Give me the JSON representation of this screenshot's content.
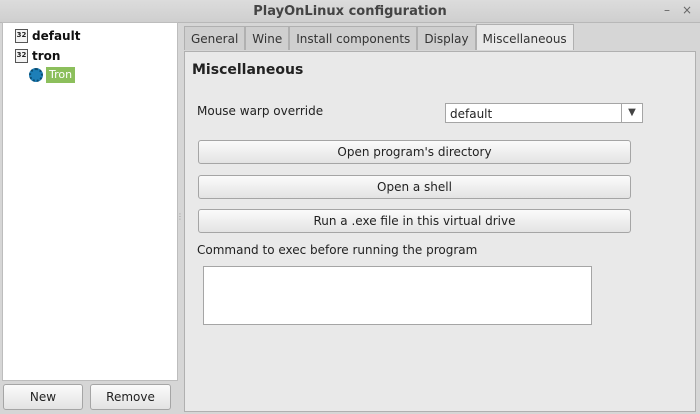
{
  "window": {
    "title": "PlayOnLinux configuration",
    "minimize_glyph": "–",
    "close_glyph": "×"
  },
  "tree": {
    "items": [
      {
        "label": "default",
        "icon": "chip-32-icon",
        "chip_text": "32"
      },
      {
        "label": "tron",
        "icon": "chip-32-icon",
        "chip_text": "32"
      }
    ],
    "child": {
      "label": "Tron",
      "icon": "gear-icon"
    }
  },
  "bottom_buttons": {
    "new_label": "New",
    "remove_label": "Remove"
  },
  "tabs": [
    "General",
    "Wine",
    "Install components",
    "Display",
    "Miscellaneous"
  ],
  "active_tab": "Miscellaneous",
  "panel": {
    "heading": "Miscellaneous",
    "mouse_warp_label": "Mouse warp override",
    "mouse_warp_value": "default",
    "open_dir_label": "Open program's directory",
    "open_shell_label": "Open a shell",
    "run_exe_label": "Run a .exe file in this virtual drive",
    "command_label": "Command to exec before running the program",
    "command_value": ""
  }
}
